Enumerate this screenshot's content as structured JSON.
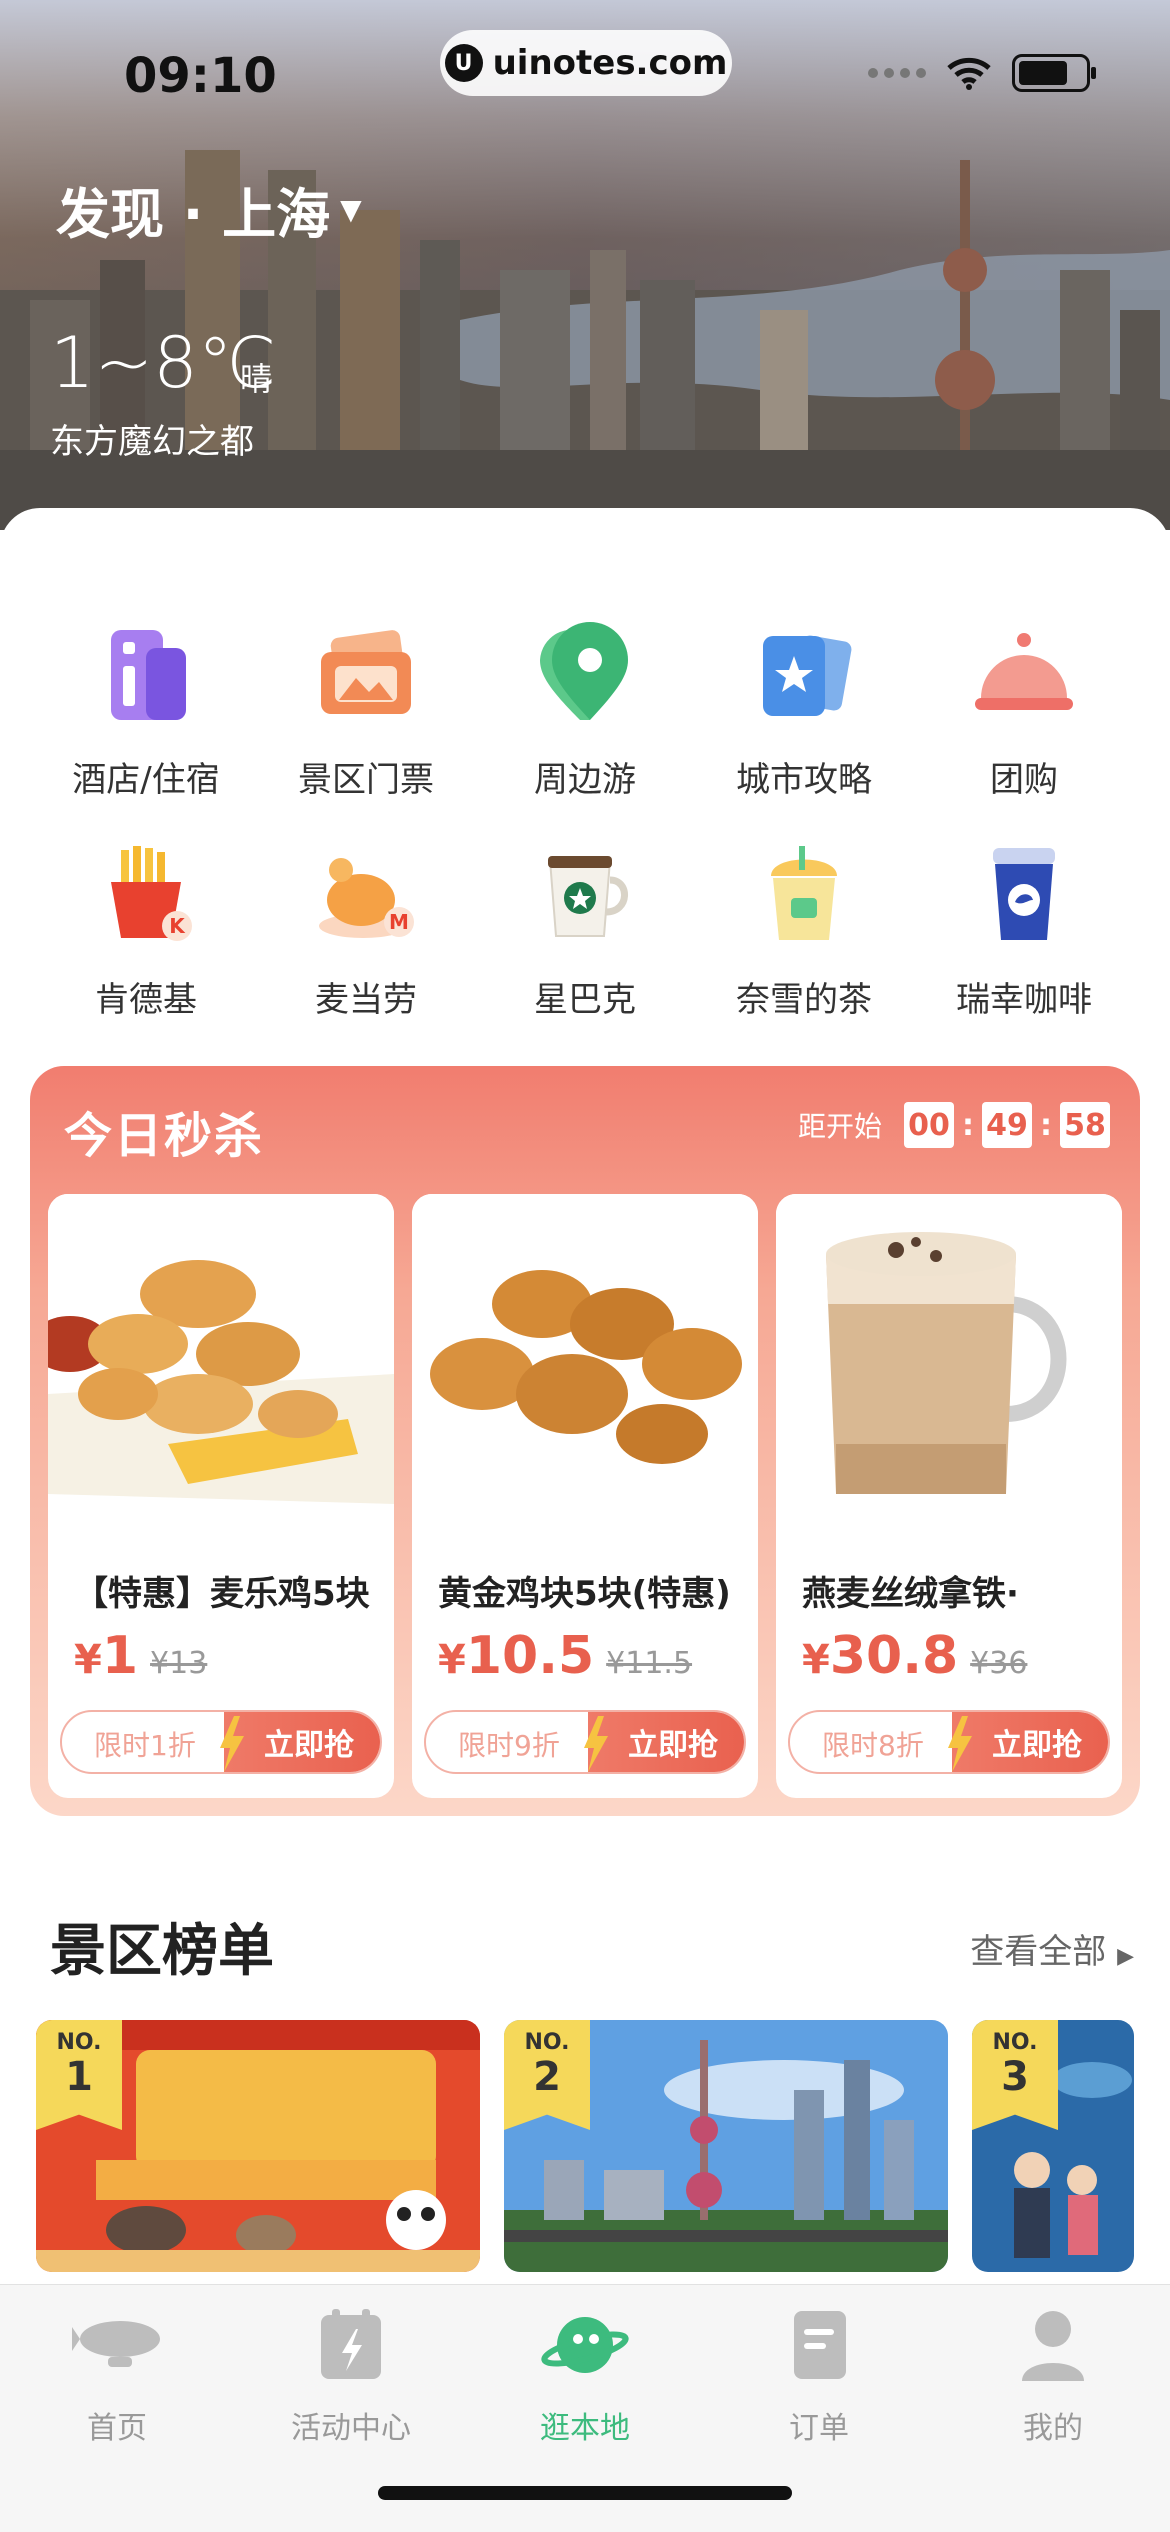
{
  "status_bar": {
    "time": "09:10",
    "url": "uinotes.com"
  },
  "header": {
    "city": "发现 · 上海",
    "temperature": "1~8℃",
    "weather": "晴",
    "slogan": "东方魔幻之都"
  },
  "categories": [
    {
      "label": "酒店/住宿",
      "icon": "hotel-icon"
    },
    {
      "label": "景区门票",
      "icon": "ticket-icon"
    },
    {
      "label": "周边游",
      "icon": "map-pin-icon"
    },
    {
      "label": "城市攻略",
      "icon": "guide-star-icon"
    },
    {
      "label": "团购",
      "icon": "food-cloche-icon"
    },
    {
      "label": "肯德基",
      "icon": "kfc-fries-icon"
    },
    {
      "label": "麦当劳",
      "icon": "mcdonalds-chicken-icon"
    },
    {
      "label": "星巴克",
      "icon": "starbucks-cup-icon"
    },
    {
      "label": "奈雪的茶",
      "icon": "nayuki-tea-icon"
    },
    {
      "label": "瑞幸咖啡",
      "icon": "luckin-coffee-icon"
    }
  ],
  "flash_sale": {
    "title": "今日秒杀",
    "countdown_label": "距开始",
    "hours": "00",
    "minutes": "49",
    "seconds": "58",
    "items": [
      {
        "name": "【特惠】麦乐鸡5块",
        "currency": "¥",
        "price": "1",
        "original": "¥13",
        "discount": "限时1折",
        "action": "立即抢"
      },
      {
        "name": "黄金鸡块5块(特惠)",
        "currency": "¥",
        "price": "10.5",
        "original": "¥11.5",
        "discount": "限时9折",
        "action": "立即抢"
      },
      {
        "name": "燕麦丝绒拿铁·",
        "currency": "¥",
        "price": "30.8",
        "original": "¥36",
        "discount": "限时8折",
        "action": "立即抢"
      }
    ]
  },
  "ranking": {
    "title": "景区榜单",
    "more": "查看全部",
    "items": [
      {
        "no_label": "NO.",
        "rank": "1"
      },
      {
        "no_label": "NO.",
        "rank": "2"
      },
      {
        "no_label": "NO.",
        "rank": "3"
      }
    ]
  },
  "tabbar": [
    {
      "label": "首页",
      "icon": "blimp-icon",
      "active": false
    },
    {
      "label": "活动中心",
      "icon": "calendar-bolt-icon",
      "active": false
    },
    {
      "label": "逛本地",
      "icon": "planet-icon",
      "active": true
    },
    {
      "label": "订单",
      "icon": "order-icon",
      "active": false
    },
    {
      "label": "我的",
      "icon": "profile-icon",
      "active": false
    }
  ],
  "colors": {
    "accent_green": "#3dbb7e",
    "sale_red": "#e8604e",
    "badge_yellow": "#f5d85a"
  }
}
